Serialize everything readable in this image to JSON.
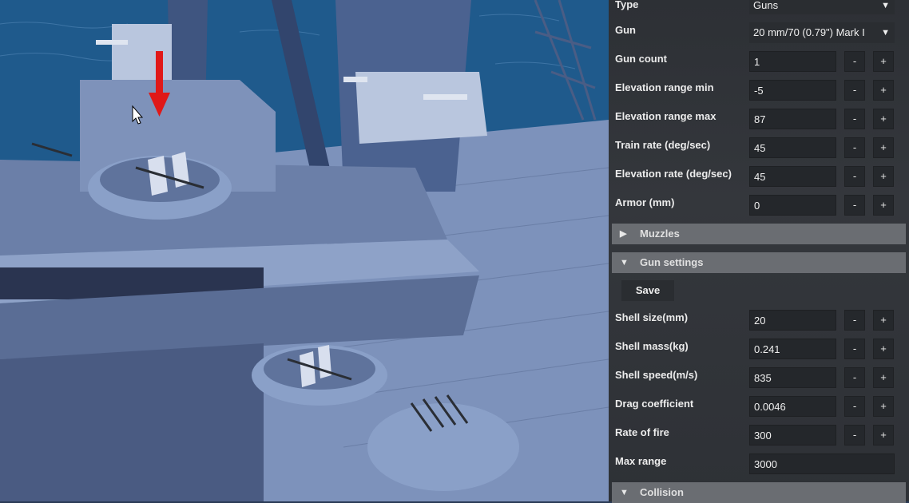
{
  "inspector": {
    "type_row": {
      "label": "Type",
      "value": "Guns"
    },
    "gun_row": {
      "label": "Gun",
      "value": "20 mm/70 (0.79\") Mark I"
    },
    "dropdown_icon": "triangle-down-icon",
    "gun_fields": [
      {
        "label": "Gun count",
        "value": "1"
      },
      {
        "label": "Elevation range min",
        "value": "-5"
      },
      {
        "label": "Elevation range max",
        "value": "87"
      },
      {
        "label": "Train rate (deg/sec)",
        "value": "45"
      },
      {
        "label": "Elevation rate (deg/sec)",
        "value": "45"
      },
      {
        "label": "Armor (mm)",
        "value": "0"
      }
    ],
    "minus_label": "-",
    "plus_label": "+",
    "sections": {
      "muzzles": {
        "title": "Muzzles",
        "state": "collapsed",
        "icon": "triangle-right-icon"
      },
      "gun_settings": {
        "title": "Gun settings",
        "state": "expanded",
        "icon": "triangle-down-icon"
      },
      "collision": {
        "title": "Collision",
        "state": "expanded",
        "icon": "triangle-down-icon"
      }
    },
    "save_label": "Save",
    "settings_fields": [
      {
        "label": "Shell size(mm)",
        "value": "20"
      },
      {
        "label": "Shell mass(kg)",
        "value": "0.241"
      },
      {
        "label": "Shell speed(m/s)",
        "value": "835"
      },
      {
        "label": "Drag coefficient",
        "value": "0.0046"
      },
      {
        "label": "Rate of fire",
        "value": "300"
      }
    ],
    "max_range": {
      "label": "Max range",
      "value": "3000"
    }
  },
  "viewport": {
    "cursor_icon": "mouse-pointer-icon",
    "marker_icon": "red-down-arrow-icon",
    "marker_color": "#e01818"
  },
  "colors": {
    "panel_bg": "#303338",
    "field_bg": "#24272b",
    "section_bg": "#6a6d72",
    "ship_hull": "#6b7fa8",
    "ocean": "#1f5a8c"
  }
}
